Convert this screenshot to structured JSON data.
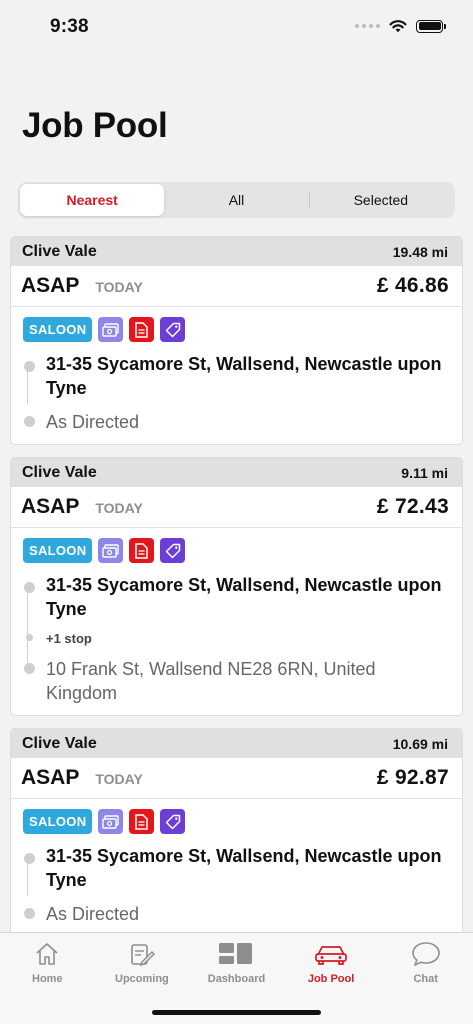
{
  "status_bar": {
    "time": "9:38"
  },
  "header": {
    "title": "Job Pool"
  },
  "filter": {
    "segments": [
      {
        "label": "Nearest",
        "active": true
      },
      {
        "label": "All",
        "active": false
      },
      {
        "label": "Selected",
        "active": false
      }
    ]
  },
  "jobs": [
    {
      "driver": "Clive Vale",
      "distance": "19.48 mi",
      "timing": "ASAP",
      "day": "TODAY",
      "price": "£ 46.86",
      "vehicle": "SALOON",
      "pickup": "31-35 Sycamore St, Wallsend, Newcastle upon Tyne",
      "extra_stops": "",
      "dropoff": "As Directed"
    },
    {
      "driver": "Clive Vale",
      "distance": "9.11 mi",
      "timing": "ASAP",
      "day": "TODAY",
      "price": "£ 72.43",
      "vehicle": "SALOON",
      "pickup": "31-35 Sycamore St, Wallsend, Newcastle upon Tyne",
      "extra_stops": "+1 stop",
      "dropoff": "10 Frank St, Wallsend NE28 6RN, United Kingdom"
    },
    {
      "driver": "Clive Vale",
      "distance": "10.69 mi",
      "timing": "ASAP",
      "day": "TODAY",
      "price": "£ 92.87",
      "vehicle": "SALOON",
      "pickup": "31-35 Sycamore St, Wallsend, Newcastle upon Tyne",
      "extra_stops": "",
      "dropoff": "As Directed"
    }
  ],
  "tabs": [
    {
      "label": "Home",
      "icon": "home-icon",
      "active": false
    },
    {
      "label": "Upcoming",
      "icon": "calendar-edit-icon",
      "active": false
    },
    {
      "label": "Dashboard",
      "icon": "dashboard-icon",
      "active": false
    },
    {
      "label": "Job Pool",
      "icon": "car-icon",
      "active": true
    },
    {
      "label": "Chat",
      "icon": "chat-bubble-icon",
      "active": false
    }
  ],
  "colors": {
    "accent": "#d81b23",
    "saloon_tag": "#2fa8dd",
    "cash_tag": "#8f86ea",
    "document_tag": "#e3161b",
    "label_tag": "#6b3fd6"
  }
}
